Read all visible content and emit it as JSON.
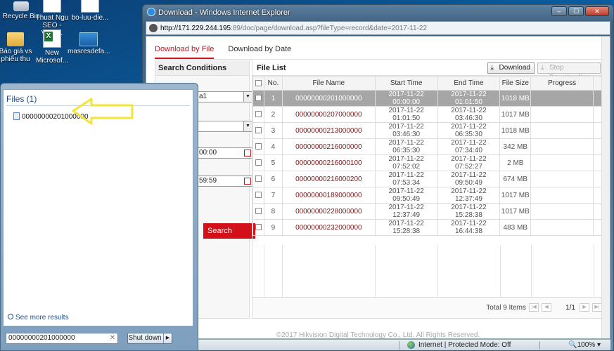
{
  "desktop": {
    "icons": [
      {
        "label": "Recycle Bin"
      },
      {
        "label": "Thuat Ngu SEO - Viets..."
      },
      {
        "label": "bo-luu-die..."
      },
      {
        "label": "Báo giá vs phiếu thu"
      },
      {
        "label": "New Microsof..."
      },
      {
        "label": "masresdefa..."
      }
    ]
  },
  "ie": {
    "title": "Download - Windows Internet Explorer",
    "address_host": "http://171.229.244.195",
    "address_rest": ":89/doc/page/download.asp?fileType=record&date=2017-11-22",
    "status_text": "Internet | Protected Mode: Off",
    "zoom": "100%"
  },
  "page": {
    "tabs": [
      "Download by File",
      "Download by Date"
    ],
    "left_panel": {
      "header": "Search Conditions",
      "select1_value": "a1",
      "start_time_value": "00:00",
      "end_time_value": "59:59",
      "search_button": "Search"
    },
    "file_list": {
      "header": "File List",
      "download_button": "Download",
      "stop_button": "Stop Downloading",
      "columns": [
        "No.",
        "File Name",
        "Start Time",
        "End Time",
        "File Size",
        "Progress"
      ],
      "rows": [
        {
          "no": "1",
          "name": "00000000201000000",
          "start": "2017-11-22 00:00:00",
          "end": "2017-11-22 01:01:50",
          "size": "1018 MB"
        },
        {
          "no": "2",
          "name": "00000000207000000",
          "start": "2017-11-22 01:01:50",
          "end": "2017-11-22 03:46:30",
          "size": "1017 MB"
        },
        {
          "no": "3",
          "name": "00000000213000000",
          "start": "2017-11-22 03:46:30",
          "end": "2017-11-22 06:35:30",
          "size": "1018 MB"
        },
        {
          "no": "4",
          "name": "00000000216000000",
          "start": "2017-11-22 06:35:30",
          "end": "2017-11-22 07:34:40",
          "size": "342 MB"
        },
        {
          "no": "5",
          "name": "00000000216000100",
          "start": "2017-11-22 07:52:02",
          "end": "2017-11-22 07:52:27",
          "size": "2 MB"
        },
        {
          "no": "6",
          "name": "00000000216000200",
          "start": "2017-11-22 07:53:34",
          "end": "2017-11-22 09:50:49",
          "size": "674 MB"
        },
        {
          "no": "7",
          "name": "00000000189000000",
          "start": "2017-11-22 09:50:49",
          "end": "2017-11-22 12:37:49",
          "size": "1017 MB"
        },
        {
          "no": "8",
          "name": "00000000228000000",
          "start": "2017-11-22 12:37:49",
          "end": "2017-11-22 15:28:38",
          "size": "1017 MB"
        },
        {
          "no": "9",
          "name": "00000000232000000",
          "start": "2017-11-22 15:28:38",
          "end": "2017-11-22 16:44:38",
          "size": "483 MB"
        }
      ],
      "total": "Total 9 Items",
      "page_indicator": "1/1"
    },
    "copyright": "©2017 Hikvision Digital Technology Co., Ltd. All Rights Reserved."
  },
  "start_menu": {
    "section_title": "Files (1)",
    "result": "00000000201000000",
    "see_more": "See more results",
    "search_value": "00000000201000000",
    "shutdown_label": "Shut down"
  },
  "colors": {
    "accent_red": "#c8171e",
    "arrow_yellow": "#f3e43a"
  }
}
